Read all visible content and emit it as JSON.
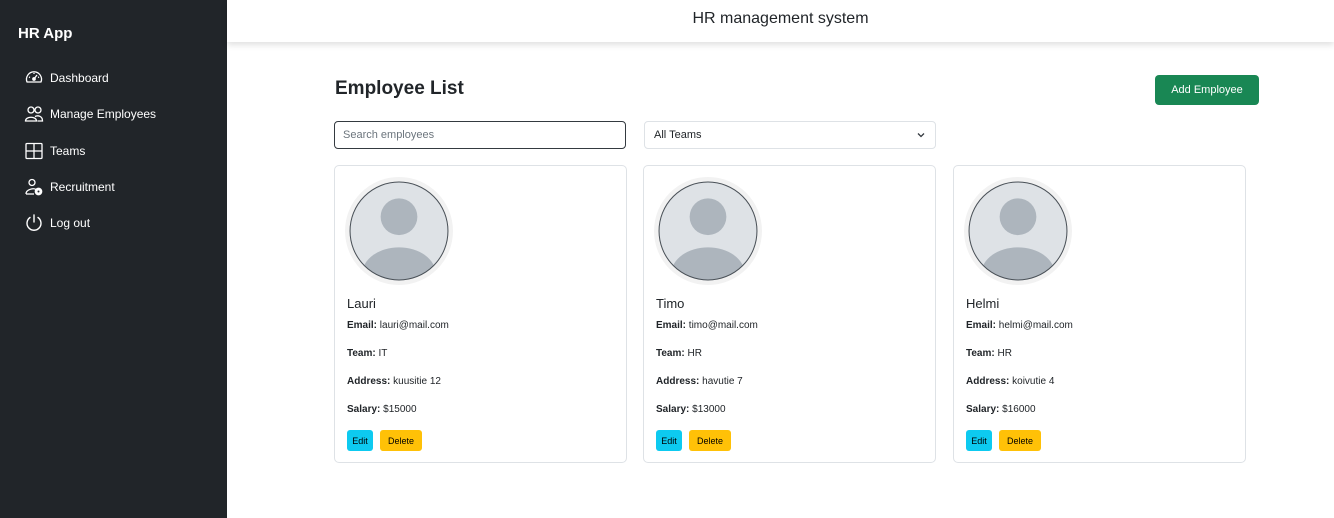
{
  "app": {
    "brand": "HR App",
    "title": "HR management system"
  },
  "sidebar": {
    "items": [
      {
        "label": "Dashboard",
        "icon": "speedometer-icon"
      },
      {
        "label": "Manage Employees",
        "icon": "people-icon"
      },
      {
        "label": "Teams",
        "icon": "layout-grid-icon"
      },
      {
        "label": "Recruitment",
        "icon": "person-gear-icon"
      },
      {
        "label": "Log out",
        "icon": "power-icon"
      }
    ]
  },
  "main": {
    "heading": "Employee List",
    "add_button": "Add Employee",
    "search_placeholder": "Search employees",
    "team_filter": "All Teams"
  },
  "labels": {
    "email": "Email:",
    "team": "Team:",
    "address": "Address:",
    "salary": "Salary:",
    "edit": "Edit",
    "delete": "Delete"
  },
  "employees": [
    {
      "name": "Lauri",
      "email": "lauri@mail.com",
      "team": "IT",
      "address": "kuusitie 12",
      "salary": "$15000"
    },
    {
      "name": "Timo",
      "email": "timo@mail.com",
      "team": "HR",
      "address": "havutie 7",
      "salary": "$13000"
    },
    {
      "name": "Helmi",
      "email": "helmi@mail.com",
      "team": "HR",
      "address": "koivutie 4",
      "salary": "$16000"
    }
  ],
  "colors": {
    "sidebar": "#212529",
    "primary_action": "#198754",
    "edit": "#0dcaf0",
    "delete": "#ffc107"
  }
}
